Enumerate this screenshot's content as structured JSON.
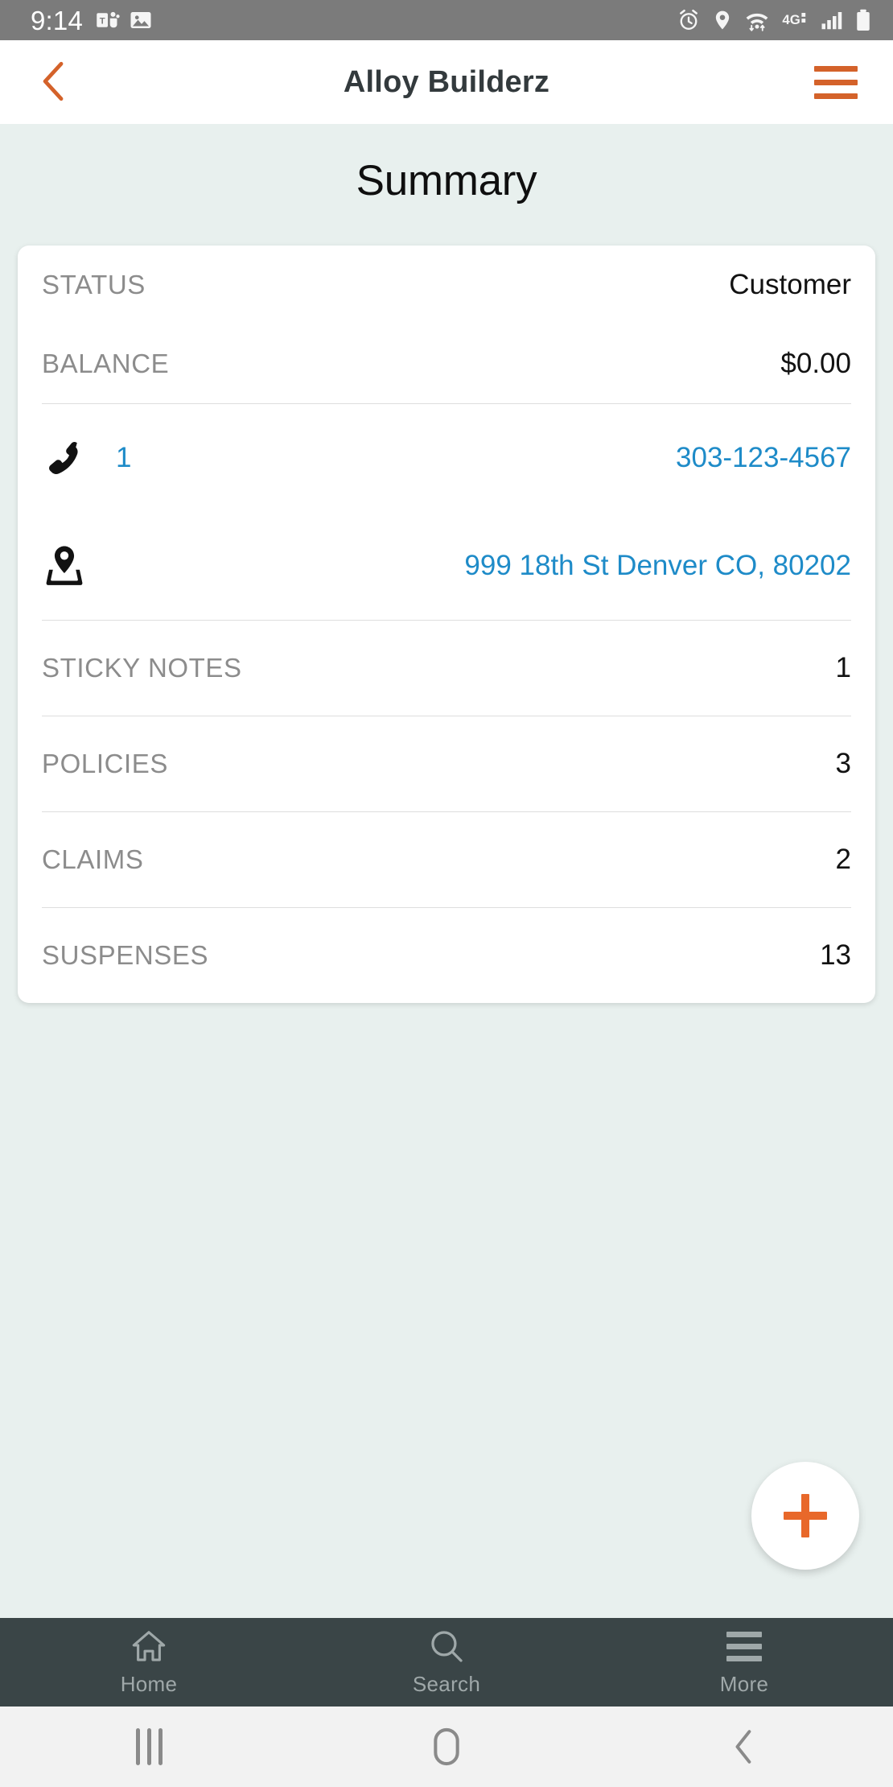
{
  "status_bar": {
    "time": "9:14",
    "left_icons": [
      "teams-icon",
      "photos-icon"
    ],
    "right_icons": [
      "alarm-icon",
      "location-icon",
      "wifi-icon",
      "network-4g-icon",
      "signal-bars-icon",
      "battery-icon"
    ],
    "network_label": "4G",
    "background_color": "#7b7b7b"
  },
  "header": {
    "title": "Alloy Builderz",
    "back_icon": "chevron-left-icon",
    "menu_icon": "hamburger-menu-icon",
    "accent_color": "#d4622a"
  },
  "page": {
    "heading": "Summary",
    "background_color": "#e8f0ee"
  },
  "summary_card": {
    "info_rows": [
      {
        "label": "STATUS",
        "value": "Customer"
      },
      {
        "label": "BALANCE",
        "value": "$0.00"
      }
    ],
    "contact_rows": [
      {
        "icon": "phone-icon",
        "label": "1",
        "value": "303-123-4567"
      },
      {
        "icon": "map-pin-icon",
        "label": "",
        "value": "999 18th St Denver CO, 80202"
      }
    ],
    "count_rows": [
      {
        "label": "STICKY NOTES",
        "value": "1"
      },
      {
        "label": "POLICIES",
        "value": "3"
      },
      {
        "label": "CLAIMS",
        "value": "2"
      },
      {
        "label": "SUSPENSES",
        "value": "13"
      }
    ],
    "link_color": "#1e8bc8"
  },
  "fab": {
    "icon": "plus-icon",
    "icon_color": "#e8682a"
  },
  "tabbar": {
    "background_color": "#3a4547",
    "items": [
      {
        "label": "Home",
        "icon": "home-icon"
      },
      {
        "label": "Search",
        "icon": "search-icon"
      },
      {
        "label": "More",
        "icon": "hamburger-menu-icon"
      }
    ]
  },
  "android_nav": {
    "buttons": [
      "recents-icon",
      "home-icon",
      "back-icon"
    ]
  }
}
